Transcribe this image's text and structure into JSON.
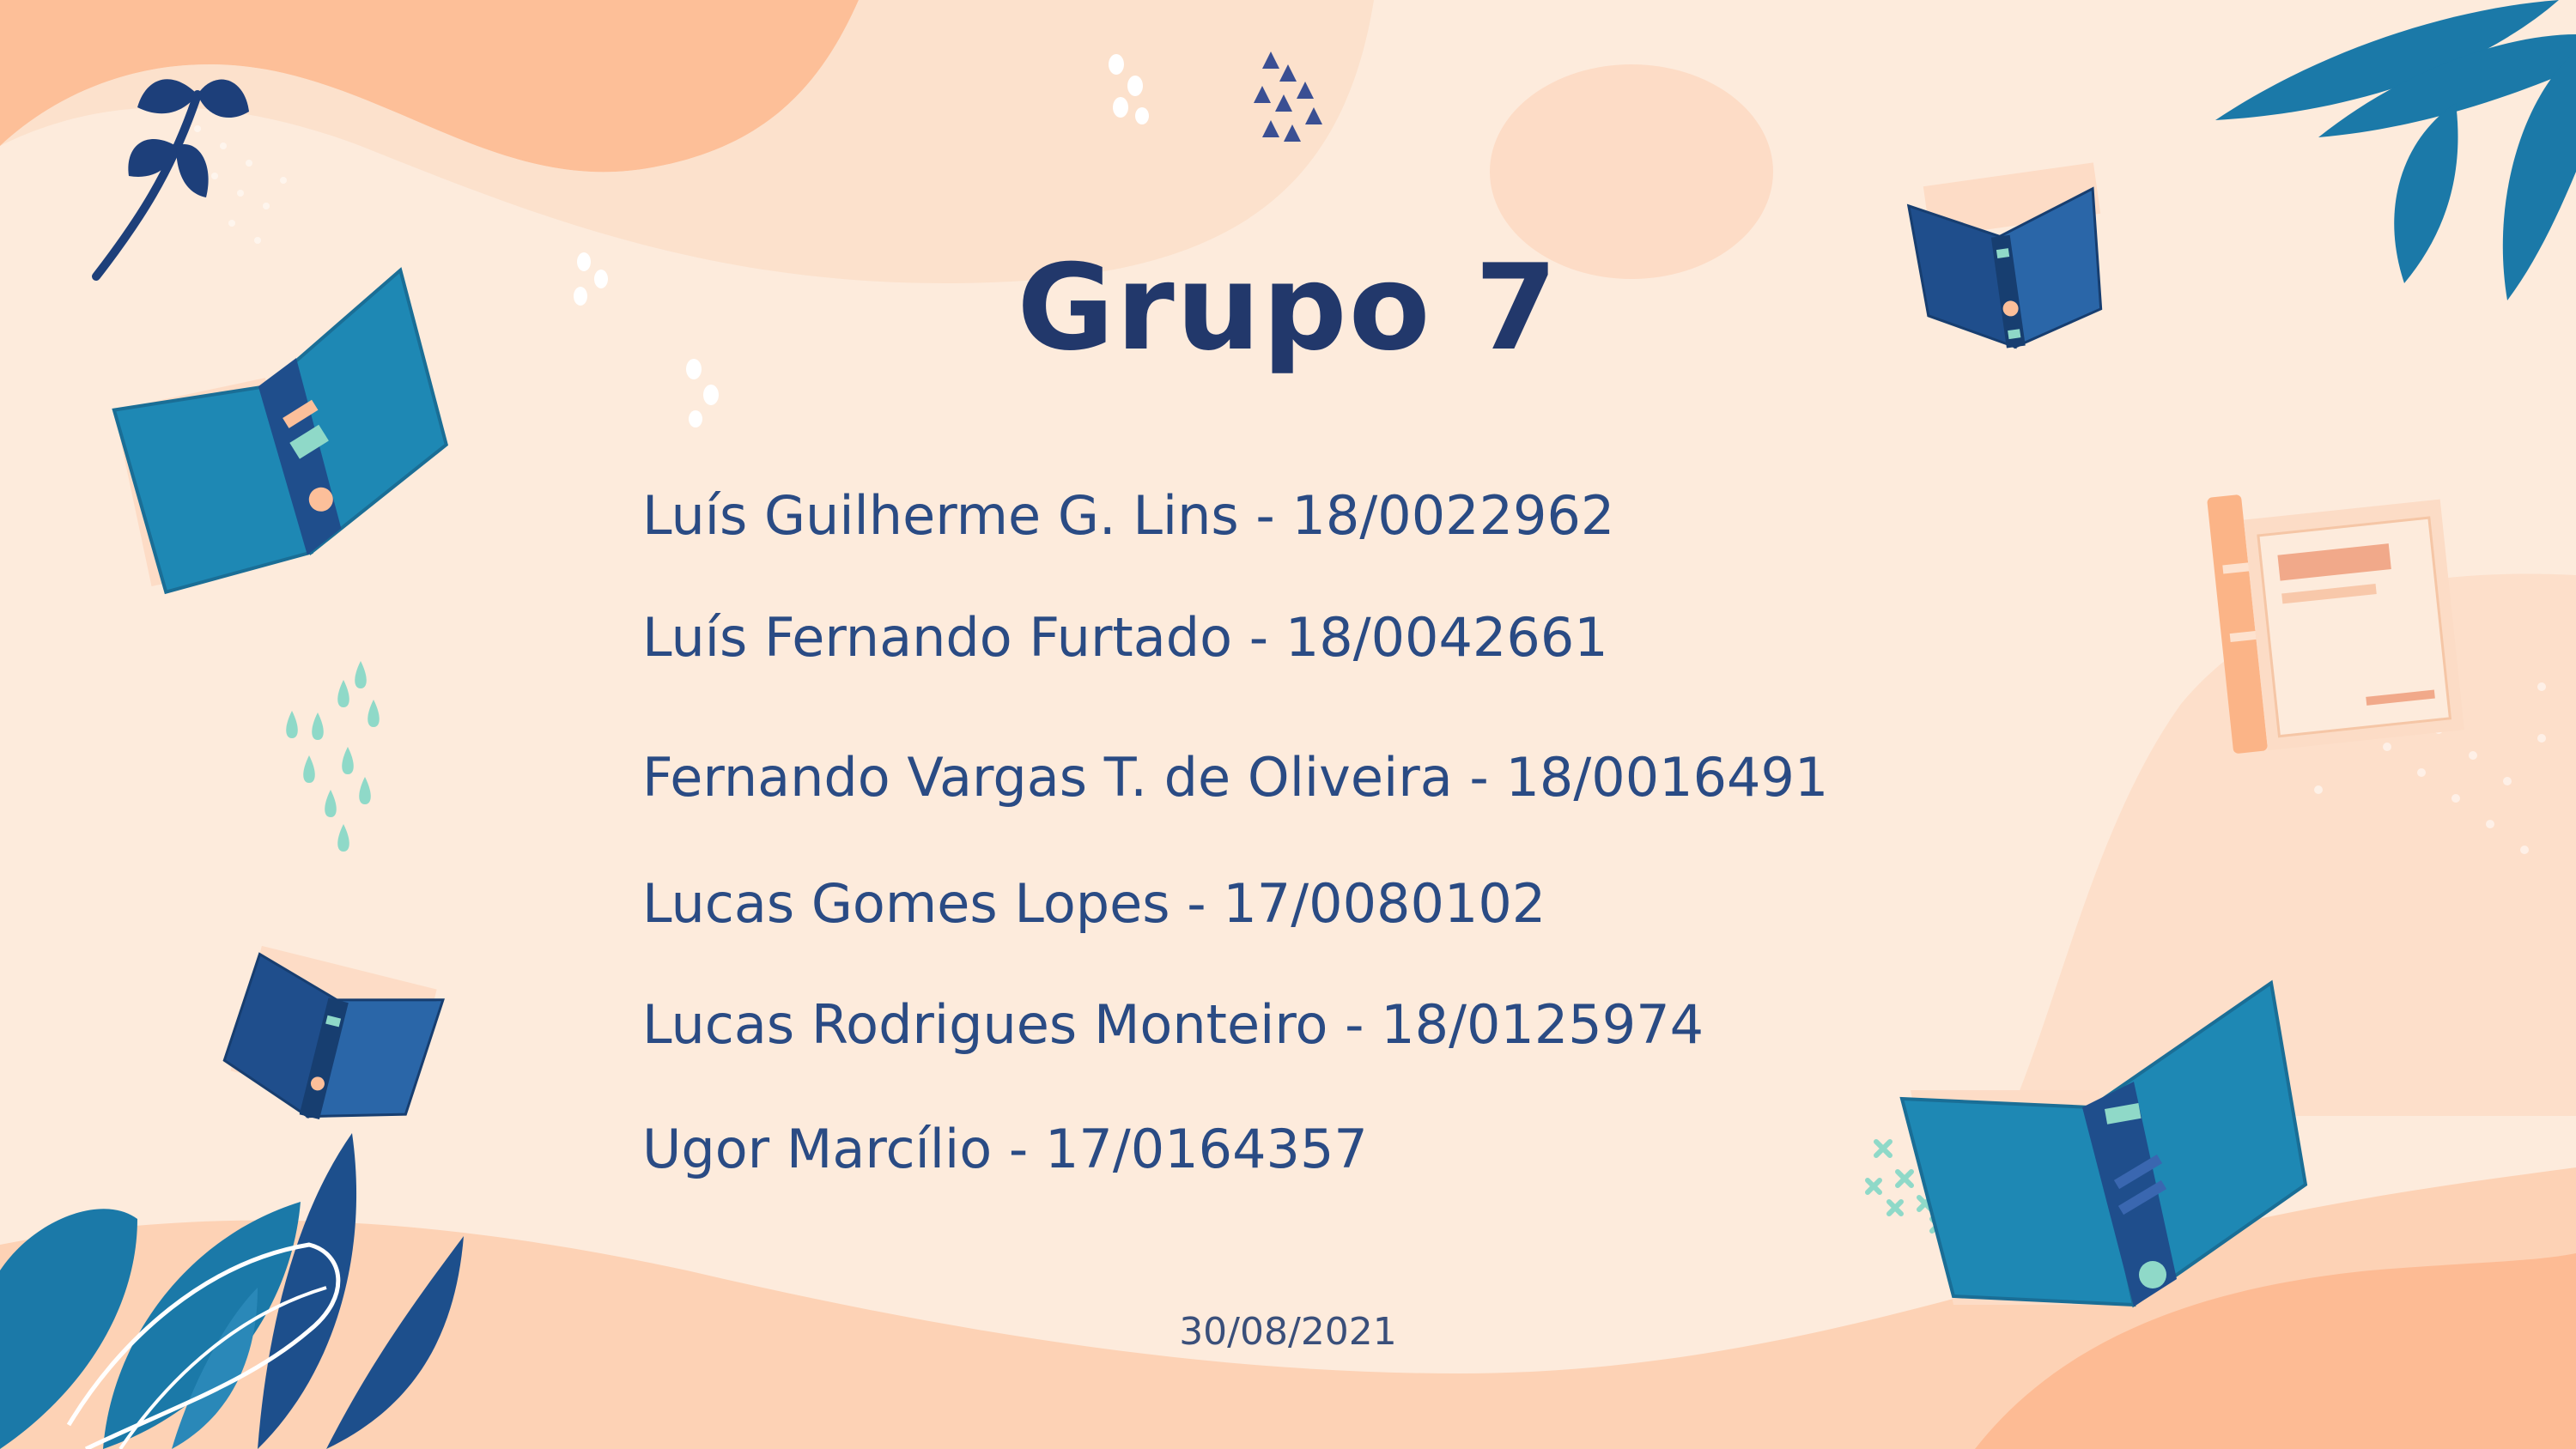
{
  "slide": {
    "title": "Grupo 7",
    "members": [
      "Luís Guilherme G. Lins - 18/0022962",
      "Luís Fernando Furtado - 18/0042661",
      "Fernando Vargas T. de Oliveira - 18/0016491",
      "Lucas Gomes Lopes - 17/0080102",
      "Lucas Rodrigues Monteiro - 18/0125974",
      "Ugor Marcílio - 17/0164357"
    ],
    "date": "30/08/2021"
  },
  "colors": {
    "background": "#fdebdc",
    "title": "#22386b",
    "text": "#2a4b84",
    "peach": "#fdbf98",
    "book_blue": "#1e88b4",
    "book_navy": "#1f4e8c",
    "leaf_teal": "#1b79a8",
    "mint": "#8fd9c8"
  },
  "decorations": [
    "leaf-icon",
    "open-book-icon",
    "drops-icon",
    "sparkle-icon"
  ]
}
